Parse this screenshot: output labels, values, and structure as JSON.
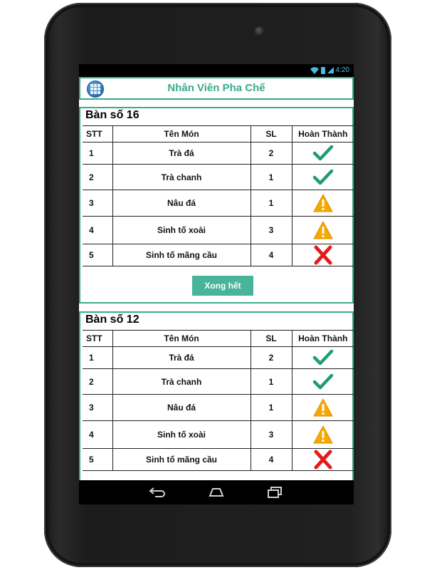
{
  "status_bar": {
    "time": "4:20",
    "icons": [
      "wifi-icon",
      "battery-icon",
      "signal-icon"
    ]
  },
  "header": {
    "title": "Nhân Viên Pha Chế",
    "menu_icon": "grid-menu-icon"
  },
  "table_headers": {
    "stt": "STT",
    "name": "Tên Món",
    "qty": "SL",
    "done": "Hoàn Thành"
  },
  "orders": [
    {
      "title": "Bàn số 16",
      "rows": [
        {
          "stt": "1",
          "name": "Trà đá",
          "qty": "2",
          "status": "done"
        },
        {
          "stt": "2",
          "name": "Trà chanh",
          "qty": "1",
          "status": "done"
        },
        {
          "stt": "3",
          "name": "Nâu đá",
          "qty": "1",
          "status": "pending"
        },
        {
          "stt": "4",
          "name": "Sinh tố xoài",
          "qty": "3",
          "status": "pending"
        },
        {
          "stt": "5",
          "name": "Sinh tố mãng cầu",
          "qty": "4",
          "status": "cancelled"
        }
      ],
      "done_all_label": "Xong hết"
    },
    {
      "title": "Bàn số 12",
      "rows": [
        {
          "stt": "1",
          "name": "Trà đá",
          "qty": "2",
          "status": "done"
        },
        {
          "stt": "2",
          "name": "Trà chanh",
          "qty": "1",
          "status": "done"
        },
        {
          "stt": "3",
          "name": "Nâu đá",
          "qty": "1",
          "status": "pending"
        },
        {
          "stt": "4",
          "name": "Sinh tố xoài",
          "qty": "3",
          "status": "pending"
        },
        {
          "stt": "5",
          "name": "Sinh tố mãng cầu",
          "qty": "4",
          "status": "cancelled"
        }
      ]
    }
  ],
  "colors": {
    "accent": "#3aaa8c",
    "check": "#1e9e6c",
    "warning": "#f5a800",
    "cross": "#e31b1b"
  },
  "nav_icons": [
    "back-icon",
    "home-icon",
    "recents-icon"
  ]
}
